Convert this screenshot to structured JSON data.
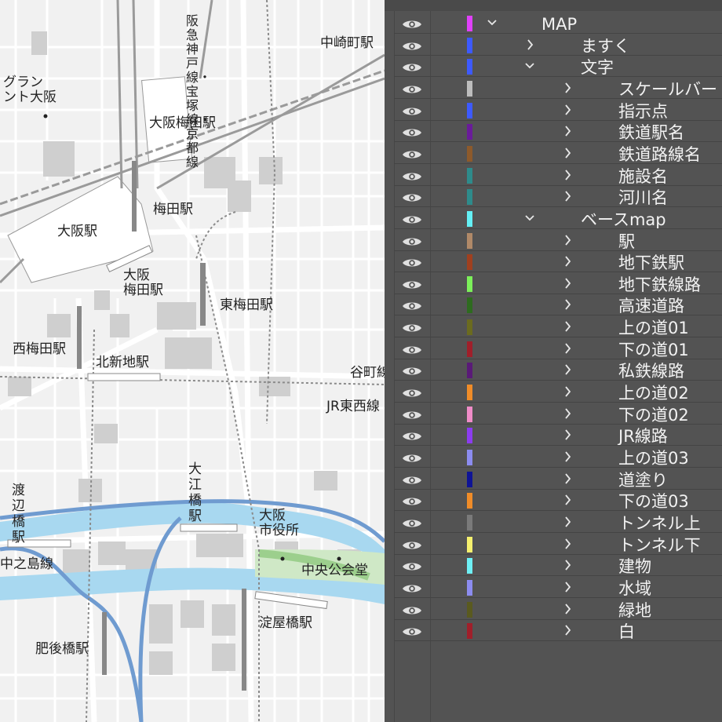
{
  "map": {
    "labels": {
      "hankyu_line": "阪急神戸線・宝塚線・京都線",
      "nakazakicho": "中崎町駅",
      "grand_front": "グラン\nント大阪",
      "osaka_umeda_hankyu": "大阪梅田駅",
      "umeda": "梅田駅",
      "osaka": "大阪駅",
      "osaka_umeda_hanshin": "大阪\n梅田駅",
      "higashi_umeda": "東梅田駅",
      "nishi_umeda": "西梅田駅",
      "kitashinchi": "北新地駅",
      "tanimachi": "谷町線",
      "jr_tozai": "JR東西線",
      "watanabebashi": "渡\n辺\n橋\n駅",
      "oebashi": "大\n江\n橋\n駅",
      "city_hall": "大阪\n市役所",
      "nakanoshima_line": "中之島線",
      "central_hall": "中央公会堂",
      "yodoyabashi": "淀屋橋駅",
      "higobashi": "肥後橋駅"
    }
  },
  "layers_panel": {
    "layers": [
      {
        "name": "MAP",
        "level": 0,
        "expanded": true,
        "color": "#e040fb"
      },
      {
        "name": "ますく",
        "level": 1,
        "expanded": false,
        "color": "#3d5afe"
      },
      {
        "name": "文字",
        "level": 1,
        "expanded": true,
        "color": "#3d5afe"
      },
      {
        "name": "スケールバー",
        "level": 2,
        "expanded": false,
        "color": "#bdbdbd"
      },
      {
        "name": "指示点",
        "level": 2,
        "expanded": false,
        "color": "#3d5afe"
      },
      {
        "name": "鉄道駅名",
        "level": 2,
        "expanded": false,
        "color": "#6a1b9a"
      },
      {
        "name": "鉄道路線名",
        "level": 2,
        "expanded": false,
        "color": "#8d5a2b"
      },
      {
        "name": "施設名",
        "level": 2,
        "expanded": false,
        "color": "#2e8b8b"
      },
      {
        "name": "河川名",
        "level": 2,
        "expanded": false,
        "color": "#2e8b8b"
      },
      {
        "name": "ベースmap",
        "level": 1,
        "expanded": true,
        "color": "#64f0f5"
      },
      {
        "name": "駅",
        "level": 2,
        "expanded": false,
        "color": "#b08968"
      },
      {
        "name": "地下鉄駅",
        "level": 2,
        "expanded": false,
        "color": "#a0401f"
      },
      {
        "name": "地下鉄線路",
        "level": 2,
        "expanded": false,
        "color": "#7cf05a"
      },
      {
        "name": "高速道路",
        "level": 2,
        "expanded": false,
        "color": "#2e6b1f"
      },
      {
        "name": "上の道01",
        "level": 2,
        "expanded": false,
        "color": "#6b6b1f"
      },
      {
        "name": "下の道01",
        "level": 2,
        "expanded": false,
        "color": "#a01f2a"
      },
      {
        "name": "私鉄線路",
        "level": 2,
        "expanded": false,
        "color": "#5a1a78"
      },
      {
        "name": "上の道02",
        "level": 2,
        "expanded": false,
        "color": "#f08c28"
      },
      {
        "name": "下の道02",
        "level": 2,
        "expanded": false,
        "color": "#f08cc8"
      },
      {
        "name": "JR線路",
        "level": 2,
        "expanded": false,
        "color": "#8c3cf0"
      },
      {
        "name": "上の道03",
        "level": 2,
        "expanded": false,
        "color": "#8c8cf0"
      },
      {
        "name": "道塗り",
        "level": 2,
        "expanded": false,
        "color": "#0f1496"
      },
      {
        "name": "下の道03",
        "level": 2,
        "expanded": false,
        "color": "#f08c28"
      },
      {
        "name": "トンネル上",
        "level": 2,
        "expanded": false,
        "color": "#7a7a7a"
      },
      {
        "name": "トンネル下",
        "level": 2,
        "expanded": false,
        "color": "#f5f06e"
      },
      {
        "name": "建物",
        "level": 2,
        "expanded": false,
        "color": "#6ef0f5"
      },
      {
        "name": "水域",
        "level": 2,
        "expanded": false,
        "color": "#8c8cf0"
      },
      {
        "name": "緑地",
        "level": 2,
        "expanded": false,
        "color": "#5a5a1f"
      },
      {
        "name": "白",
        "level": 2,
        "expanded": false,
        "color": "#a01f2a"
      }
    ]
  }
}
